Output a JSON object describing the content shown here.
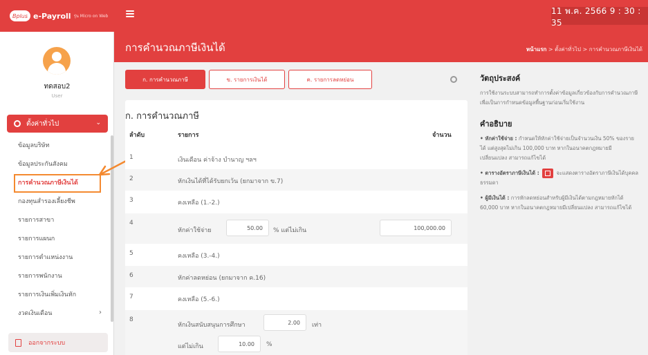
{
  "topbar": {
    "logo_text": "Bplus",
    "brand_name": "e-Payroll",
    "brand_sub": "รุ่น Micro on Web",
    "datetime": "11 พ.ค. 2566  9 : 30 : 35"
  },
  "header": {
    "title": "การคำนวณภาษีเงินได้",
    "breadcrumb_home": "หน้าแรก",
    "breadcrumb_rest": " > ตั้งค่าทั่วไป > การคำนวณภาษีเงินได้"
  },
  "sidebar": {
    "user_name": "ทดสอบ2",
    "user_role": "User",
    "group_label": "ตั้งค่าทั่วไป",
    "items": [
      {
        "label": "ข้อมูลบริษัท"
      },
      {
        "label": "ข้อมูลประกันสังคม"
      },
      {
        "label": "การคำนวณภาษีเงินได้"
      },
      {
        "label": "กองทุนสำรองเลี้ยงชีพ"
      },
      {
        "label": "รายการสาขา"
      },
      {
        "label": "รายการแผนก"
      },
      {
        "label": "รายการตำแหน่งงาน"
      },
      {
        "label": "รายการพนักงาน"
      },
      {
        "label": "รายการเงินเพิ่มเงินหัก"
      },
      {
        "label": "งวดเงินเดือน"
      }
    ],
    "logout_label": "ออกจากระบบ"
  },
  "tabs": [
    {
      "label": "ก. การคำนวณภาษี"
    },
    {
      "label": "ข. รายการเงินได้"
    },
    {
      "label": "ค. รายการลดหย่อน"
    }
  ],
  "table": {
    "title": "ก. การคำนวณภาษี",
    "headers": {
      "no": "ลำดับ",
      "item": "รายการ",
      "amount": "จำนวน"
    },
    "rows": [
      {
        "no": "1",
        "text": "เงินเดือน ค่าจ้าง บำนาญ ฯลฯ"
      },
      {
        "no": "2",
        "text": "หักเงินได้ที่ได้รับยกเว้น (ยกมาจาก ข.7)"
      },
      {
        "no": "3",
        "text": "คงเหลือ (1.-2.)"
      },
      {
        "no": "4",
        "text": "หักค่าใช้จ่าย",
        "percent": "50.00",
        "mid": "% แต่ไม่เกิน",
        "cap": "100,000.00"
      },
      {
        "no": "5",
        "text": "คงเหลือ (3.-4.)"
      },
      {
        "no": "6",
        "text": "หักค่าลดหย่อน (ยกมาจาก ค.16)"
      },
      {
        "no": "7",
        "text": "คงเหลือ (5.-6.)"
      },
      {
        "no": "8",
        "text": "หักเงินสนับสนุนการศึกษา",
        "times": "2.00",
        "times_unit": "เท่า",
        "text2": "แต่ไม่เกิน",
        "limit": "10.00",
        "limit_unit": "%"
      }
    ]
  },
  "info": {
    "objective_title": "วัตถุประสงค์",
    "objective_text": "การใช้งานระบบสามารถทำการตั้งค่าข้อมูลเกี่ยวข้องกับการคำนวณภาษี เพื่อเป็นการกำหนดข้อมูลพื้นฐานก่อนเริ่มใช้งาน",
    "desc_title": "คำอธิบาย",
    "d1_label": "• หักค่าใช้จ่าย :",
    "d1_text": " กำหนดให้หักค่าใช้จ่ายเป็นจำนวนเงิน 50% ของรายได้ แต่สูงสุดไม่เกิน 100,000 บาท หากในอนาคตกฎหมายมีเปลี่ยนแปลง สามารถแก้ไขได้",
    "d2_label": "• ตารางอัตราภาษีเงินได้ :",
    "d2_text": " จะแสดงตารางอัตราภาษีเงินได้บุคคลธรรมดา",
    "d3_label": "• ผู้มีเงินได้ :",
    "d3_text": " การหักลดหย่อนสำหรับผู้มีเงินได้ตามกฎหมายหักได้ 60,000 บาท หากในอนาคตกฎหมายมีเปลี่ยนแปลง สามารถแก้ไขได้"
  }
}
